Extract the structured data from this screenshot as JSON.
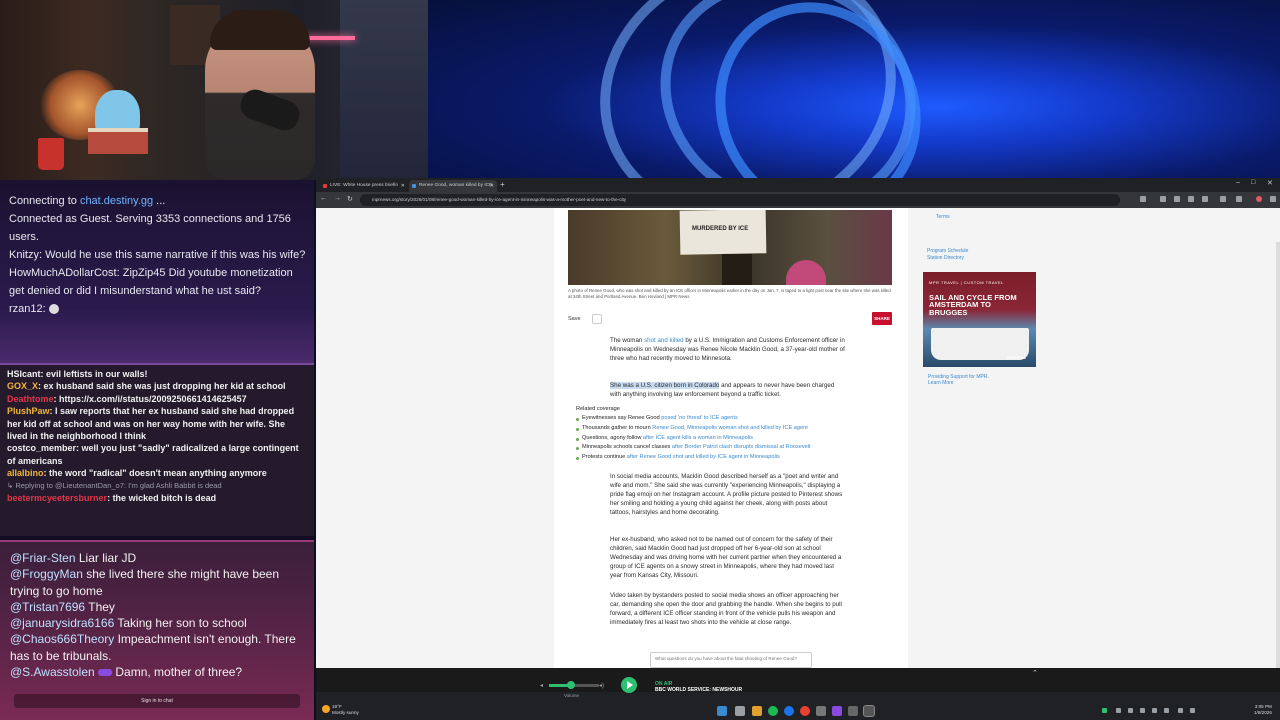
{
  "chat": {
    "status_lines": [
      {
        "prefix": "Connecting to ",
        "link": "chat.destiny.gg",
        "suffix": " ..."
      },
      {
        "text": "Connected as Guest. Serving 3353 connections and 1756 users."
      }
    ],
    "top_messages": [
      {
        "user": "Knitzy",
        "text": "Would he use this same narrative if this was his wife?"
      },
      {
        "user": "HowMuchADollarCost",
        "text": "ZipZip45 Did youtube monetization get denied or did I misunderstand what he ust said?"
      },
      {
        "user": "rzan12",
        "text": ""
      }
    ],
    "mid_messages": [
      {
        "user": "HSIcant",
        "user_color": "#f2f2f2",
        "text": "evil leftists in our walls!"
      },
      {
        "user": "GOX_X",
        "user_color": "#f2b63a",
        "text": "ex husband said she was just dropping her kid at school"
      },
      {
        "user": "Deathtome",
        "user_color": "#e0344a",
        "text": "https://x.com/i/status/2009250661414625457"
      },
      {
        "user": "PlushPaw",
        "user_color": "#f2b63a",
        "text": "I saw reports that her ex husband said she had dropped her kid off at school and was on her way home with her wife. She lived in the neighborhood I think"
      },
      {
        "user": "costco_member",
        "user_color": "#f2f2f2",
        "text": "well you just \"sadly\" radicalized a large contingent of americans"
      },
      {
        "user": "allalbino",
        "user_color": "#f2b63a",
        "text": "the word \"radical\" doesn't mean anything anymore"
      },
      {
        "reply": "Replying to @LieutenantDan_o7: I'm glad Ashli Babbit is dead"
      },
      {
        "user": "beetermcyeetersburner",
        "user_color": "#e0344a",
        "text": "the wicked bitch is dead"
      }
    ],
    "bottom_messages": [
      {
        "user": "@Friar-Sten",
        "text": "Liar liar JD"
      },
      {
        "user": "@FroggyMan",
        "text": "she lived there she might have been trying to go home"
      },
      {
        "user": "@Tristan7696",
        "text": "They"
      },
      {
        "user": "@januarysidra6166",
        "text": "Taking her son to school"
      },
      {
        "user": "@Chaos666Theory",
        "text": "Impeachment isn't enough. There has to be tribunals."
      },
      {
        "user": "@S.Awasstolen",
        "text": "Damn, mother of three?"
      }
    ],
    "signin_label": "Sign in to chat"
  },
  "browser": {
    "tabs": [
      {
        "title": "LIVE: White House press briefin",
        "active": false,
        "favicon_color": "#e53935"
      },
      {
        "title": "Renee Good, woman killed by ICE",
        "active": true,
        "favicon_color": "#4a90d9"
      }
    ],
    "new_tab_label": "+",
    "url": "mprnews.org/story/2026/01/08/renee-good-woman-killed-by-ice-agent-in-minneapolis-was-a-mother-poet-and-new-to-the-city",
    "nav": {
      "back": "←",
      "forward": "→",
      "reload": "↻"
    },
    "window_controls": {
      "minimize": "–",
      "maximize": "□",
      "close": "✕"
    }
  },
  "article": {
    "hero_sign_text": "MURDERED BY ICE",
    "caption": "A photo of Renee Good, who was shot and killed by an ICE officer in Minneapolis earlier in the day on Jan. 7, is taped to a light post near the site where she was killed at 34th Street and Portland Avenue.  Ben Hovland | MPR News",
    "save_label": "Save",
    "share_label": "SHARE",
    "p1_a": "The woman ",
    "p1_link": "shot and killed",
    "p1_b": " by a U.S. Immigration and Customs Enforcement officer in Minneapolis on Wednesday was Renee Nicole Macklin Good, a 37-year-old mother of three who had recently moved to Minnesota.",
    "p2_highlight": "She was a U.S. citizen born in Colorado",
    "p2_rest": " and appears to never have been charged with anything involving law enforcement beyond a traffic ticket.",
    "related_heading": "Related coverage",
    "related": [
      {
        "label": "Eyewitnesses say Renee Good",
        "link": "posed 'no threat' to ICE agents"
      },
      {
        "label": "Thousands gather to mourn",
        "link": "Renee Good, Minneapolis woman shot and killed by ICE agent"
      },
      {
        "label": "Questions, agony follow",
        "link": "after ICE agent kills a woman in Minneapolis"
      },
      {
        "label": "Minneapolis schools cancel classes",
        "link": "after Border Patrol clash disrupts dismissal at Roosevelt"
      },
      {
        "label": "Protests continue",
        "link": "after Renee Good shot and killed by ICE agent in Minneapolis"
      }
    ],
    "p3": "In social media accounts, Macklin Good described herself as a \"poet and writer and wife and mom.\" She said she was currently \"experiencing Minneapolis,\" displaying a pride flag emoji on her Instagram account. A profile picture posted to Pinterest shows her smiling and holding a young child against her cheek, along with posts about tattoos, hairstyles and home decorating.",
    "p4": "Her ex-husband, who asked not to be named out of concern for the safety of their children, said Macklin Good had just dropped off her 6-year-old son at school Wednesday and was driving home with her current partner when they encountered a group of ICE agents on a snowy street in Minneapolis, where they had moved last year from Kansas City, Missouri.",
    "p5": "Video taken by bystanders posted to social media shows an officer approaching her car, demanding she open the door and grabbing the handle. When she begins to pull forward, a different ICE officer standing in front of the vehicle pulls his weapon and immediately fires at least two shots into the vehicle at close range.",
    "ask_box": "What questions do you have about the fatal shooting of Renee Good?"
  },
  "rail": {
    "terms": "Terms",
    "links": [
      "Program Schedule",
      "Station Directory"
    ],
    "ad_kicker": "MPR TRAVEL | CUSTOM TRAVEL",
    "ad_title": "SAIL AND CYCLE FROM AMSTERDAM TO BRUGGES",
    "ad_brand": "MPRNEWS",
    "support_1": "Providing Support for MPR.",
    "support_2": "Learn More"
  },
  "player": {
    "volume_label": "Volume",
    "on_air": "ON AIR",
    "station": "BBC WORLD SERVICE: NEWSHOUR",
    "volume_level": 0.4,
    "expand_icon": "⌃"
  },
  "taskbar": {
    "weather_temp": "19°F",
    "weather_desc": "Mostly sunny",
    "time": "3:05 PM",
    "date": "1/8/2026"
  }
}
